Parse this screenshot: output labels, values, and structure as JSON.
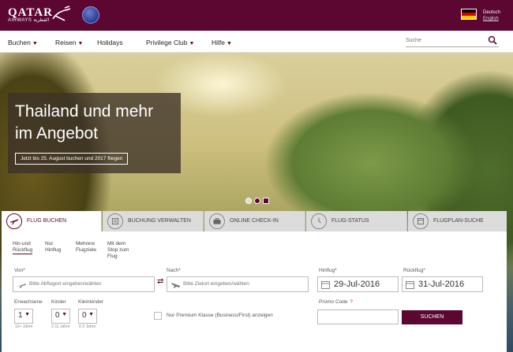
{
  "header": {
    "logo_main": "QATAR",
    "logo_sub": "AIRWAYS القطرية",
    "language_current": "Deutsch",
    "language_alt": "English"
  },
  "nav": {
    "items": [
      {
        "label": "Buchen",
        "dropdown": true
      },
      {
        "label": "Reisen",
        "dropdown": true
      },
      {
        "label": "Holidays",
        "dropdown": false
      },
      {
        "label": "Privilege Club",
        "dropdown": true
      },
      {
        "label": "Hilfe",
        "dropdown": true
      }
    ],
    "search_placeholder": "Suche"
  },
  "hero": {
    "title_line1": "Thailand und mehr",
    "title_line2": "im Angebot",
    "cta": "Jetzt bis 25. August buchen und 2017 fliegen",
    "slides": 3,
    "active_slide": 2
  },
  "tabs": [
    {
      "label": "FLUG BUCHEN",
      "icon": "plane-icon",
      "active": true
    },
    {
      "label": "BUCHUNG VERWALTEN",
      "icon": "list-icon",
      "active": false
    },
    {
      "label": "ONLINE CHECK-IN",
      "icon": "suitcase-icon",
      "active": false
    },
    {
      "label": "FLUG-STATUS",
      "icon": "clock-icon",
      "active": false
    },
    {
      "label": "FLUGPLAN-SUCHE",
      "icon": "calendar-icon",
      "active": false
    }
  ],
  "booking": {
    "trip_types": [
      {
        "label1": "Hin-und",
        "label2": "Rückflug",
        "label3": "",
        "active": true
      },
      {
        "label1": "Nur",
        "label2": "Hinflug",
        "label3": "",
        "active": false
      },
      {
        "label1": "Mehrere",
        "label2": "Flugziele",
        "label3": "",
        "active": false
      },
      {
        "label1": "Mit dem",
        "label2": "Stop zum",
        "label3": "Flug",
        "active": false
      }
    ],
    "from_label": "Von*",
    "from_placeholder": "Bitte Abflugort eingeben/wählen",
    "to_label": "Nach*",
    "to_placeholder": "Bitte Zielort eingeben/wählen",
    "depart_label": "Hinflug*",
    "depart_value": "29-Jul-2016",
    "return_label": "Rückflug*",
    "return_value": "31-Jul-2016",
    "adults_label": "Erwachsene",
    "adults_value": "1",
    "adults_hint": "12+ Jahre",
    "children_label": "Kinder",
    "children_value": "0",
    "children_hint": "2-11 Jahre",
    "infants_label": "Kleinkinder",
    "infants_value": "0",
    "infants_hint": "0-2 Jahre",
    "premium_label": "Nur Premium Klasse (Business/First) anzeigen",
    "promo_label": "Promo Code",
    "promo_help": "?",
    "submit": "SUCHEN"
  }
}
